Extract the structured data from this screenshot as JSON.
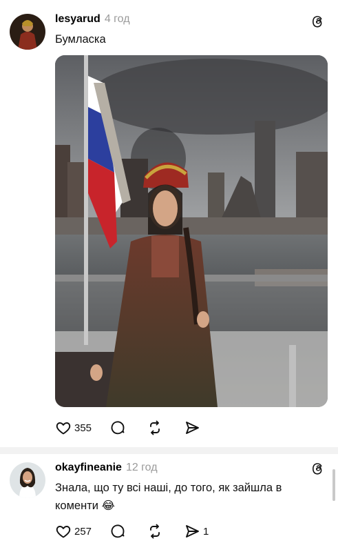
{
  "post": {
    "username": "lesyarud",
    "time": "4 год",
    "text": "Бумласка",
    "actions": {
      "likes": "355",
      "comments": "",
      "reposts": "",
      "shares": ""
    }
  },
  "reply": {
    "username": "okayfineanie",
    "time": "12 год",
    "text": "Знала, що ту всі наші, до того, як зайшла в коменти 😂",
    "actions": {
      "likes": "257",
      "comments": "",
      "reposts": "",
      "shares": "1"
    }
  },
  "colors": {
    "text": "#000000",
    "muted": "#9a9a9a",
    "flag_white": "#ffffff",
    "flag_blue": "#2c3f9e",
    "flag_red": "#c8242b"
  },
  "icons": [
    "heart-icon",
    "comment-icon",
    "repost-icon",
    "share-icon",
    "threads-logo-icon"
  ]
}
